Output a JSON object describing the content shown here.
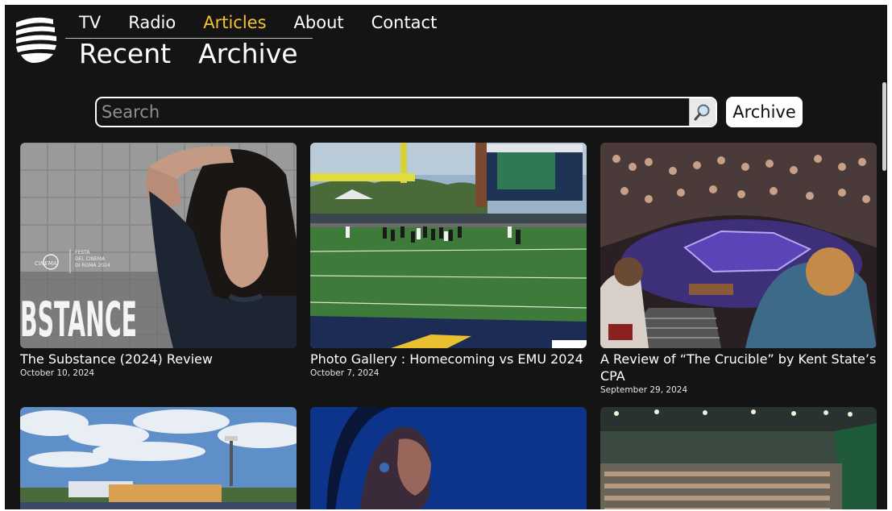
{
  "nav": {
    "items": [
      {
        "label": "TV",
        "active": false
      },
      {
        "label": "Radio",
        "active": false
      },
      {
        "label": "Articles",
        "active": true
      },
      {
        "label": "About",
        "active": false
      },
      {
        "label": "Contact",
        "active": false
      }
    ],
    "sub_items": [
      {
        "label": "Recent"
      },
      {
        "label": "Archive"
      }
    ]
  },
  "search": {
    "placeholder": "Search",
    "value": "",
    "button_icon": "magnifier-icon"
  },
  "archive_button": {
    "label": "Archive"
  },
  "articles": [
    {
      "title": "The Substance (2024) Review",
      "date": "October 10, 2024",
      "image": "substance-poster",
      "poster_text": "BSTANCE",
      "festival_text": "FESTA DEL CINEMA DI ROMA 2024"
    },
    {
      "title": "Photo Gallery : Homecoming vs EMU 2024",
      "date": "October 7, 2024",
      "image": "football-field"
    },
    {
      "title": "A Review of “The Crucible” by Kent State’s CPA",
      "date": "September 29, 2024",
      "image": "theater-stage"
    },
    {
      "title": "",
      "date": "",
      "image": "stadium-sky"
    },
    {
      "title": "",
      "date": "",
      "image": "blue-portrait"
    },
    {
      "title": "",
      "date": "",
      "image": "arena-crowd"
    }
  ],
  "colors": {
    "background": "#141414",
    "accent": "#f2c230",
    "text": "#ffffff"
  }
}
